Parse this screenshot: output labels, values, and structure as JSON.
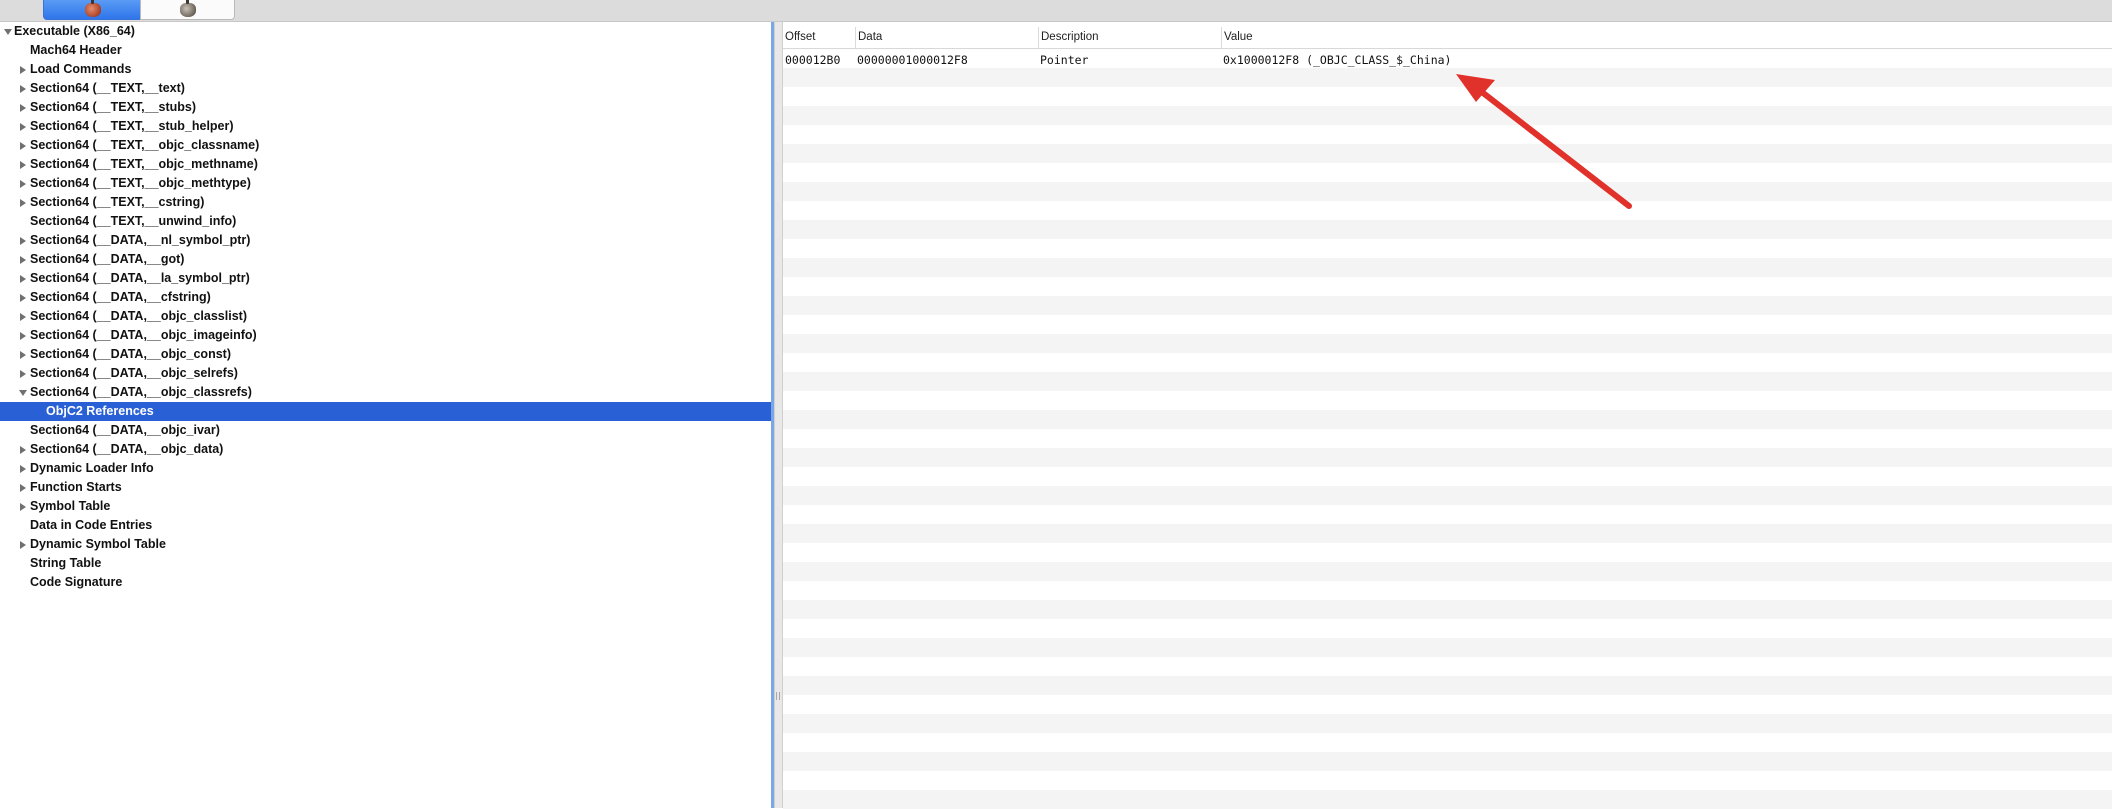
{
  "toolbar": {
    "segments": [
      {
        "icon": "app-icon-red",
        "selected": true
      },
      {
        "icon": "app-icon-gray",
        "selected": false
      }
    ]
  },
  "tree": {
    "items": [
      {
        "label": "Executable  (X86_64)",
        "expanded": true
      },
      {
        "label": "Mach64 Header"
      },
      {
        "label": "Load Commands",
        "expandable": true
      },
      {
        "label": "Section64 (__TEXT,__text)",
        "expandable": true
      },
      {
        "label": "Section64 (__TEXT,__stubs)",
        "expandable": true
      },
      {
        "label": "Section64 (__TEXT,__stub_helper)",
        "expandable": true
      },
      {
        "label": "Section64 (__TEXT,__objc_classname)",
        "expandable": true
      },
      {
        "label": "Section64 (__TEXT,__objc_methname)",
        "expandable": true
      },
      {
        "label": "Section64 (__TEXT,__objc_methtype)",
        "expandable": true
      },
      {
        "label": "Section64 (__TEXT,__cstring)",
        "expandable": true
      },
      {
        "label": "Section64 (__TEXT,__unwind_info)"
      },
      {
        "label": "Section64 (__DATA,__nl_symbol_ptr)",
        "expandable": true
      },
      {
        "label": "Section64 (__DATA,__got)",
        "expandable": true
      },
      {
        "label": "Section64 (__DATA,__la_symbol_ptr)",
        "expandable": true
      },
      {
        "label": "Section64 (__DATA,__cfstring)",
        "expandable": true
      },
      {
        "label": "Section64 (__DATA,__objc_classlist)",
        "expandable": true
      },
      {
        "label": "Section64 (__DATA,__objc_imageinfo)",
        "expandable": true
      },
      {
        "label": "Section64 (__DATA,__objc_const)",
        "expandable": true
      },
      {
        "label": "Section64 (__DATA,__objc_selrefs)",
        "expandable": true
      },
      {
        "label": "Section64 (__DATA,__objc_classrefs)",
        "expandable": true,
        "expanded": true
      },
      {
        "label": "ObjC2 References",
        "selected": true
      },
      {
        "label": "Section64 (__DATA,__objc_ivar)"
      },
      {
        "label": "Section64 (__DATA,__objc_data)",
        "expandable": true
      },
      {
        "label": "Dynamic Loader Info",
        "expandable": true
      },
      {
        "label": "Function Starts",
        "expandable": true
      },
      {
        "label": "Symbol Table",
        "expandable": true
      },
      {
        "label": "Data in Code Entries"
      },
      {
        "label": "Dynamic Symbol Table",
        "expandable": true
      },
      {
        "label": "String Table"
      },
      {
        "label": "Code Signature"
      }
    ]
  },
  "table": {
    "columns": [
      "Offset",
      "Data",
      "Description",
      "Value"
    ],
    "rows": [
      {
        "offset": "000012B0",
        "data": "00000001000012F8",
        "description": "Pointer",
        "value": "0x1000012F8  (_OBJC_CLASS_$_China)"
      }
    ]
  },
  "annotation": {
    "arrow_color": "#e0322b"
  }
}
